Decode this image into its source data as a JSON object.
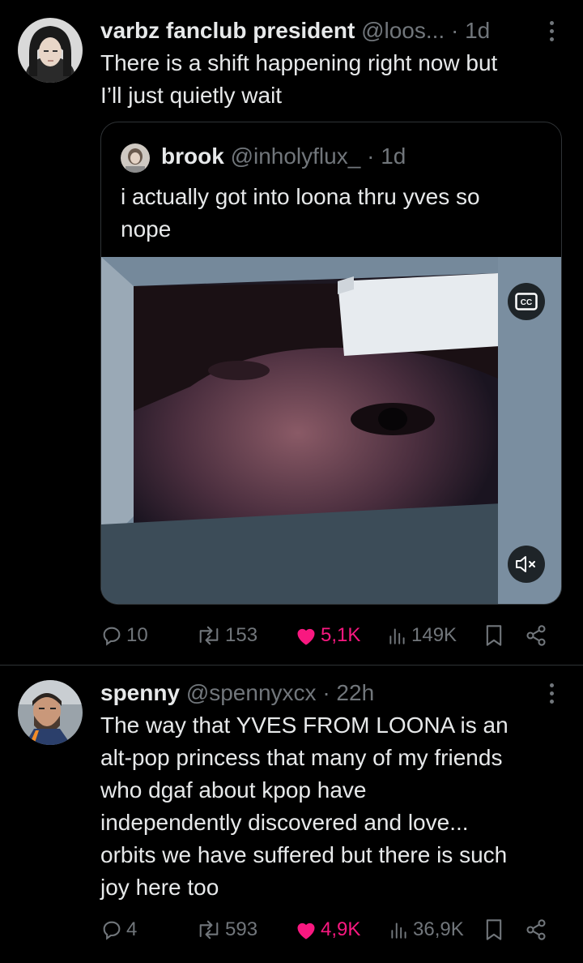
{
  "tweets": [
    {
      "author_name": "varbz fanclub president",
      "handle": "@loos...",
      "separator": "·",
      "time": "1d",
      "text_lines": [
        "There is a shift happening right now but",
        "I’ll just quietly wait"
      ],
      "quote": {
        "author_name": "brook",
        "handle": "@inholyflux_",
        "separator": "·",
        "time": "1d",
        "text_lines": [
          "i actually got into loona thru yves so",
          "nope"
        ],
        "media": {
          "type": "video",
          "captions_button": "CC",
          "mute_icon": "speaker-muted-icon"
        }
      },
      "actions": {
        "replies": "10",
        "reposts": "153",
        "likes": "5,1K",
        "views": "149K",
        "liked": true
      }
    },
    {
      "author_name": "spenny",
      "handle": "@spennyxcx",
      "separator": "·",
      "time": "22h",
      "text_lines": [
        "The way that YVES FROM LOONA is an",
        "alt-pop princess that many of my friends",
        "who dgaf about kpop have",
        "independently discovered and love...",
        "orbits we have suffered but there is such",
        "joy here too"
      ],
      "actions": {
        "replies": "4",
        "reposts": "593",
        "likes": "4,9K",
        "views": "36,9K",
        "liked": true
      }
    }
  ],
  "colors": {
    "background": "#000000",
    "text": "#e7e9ea",
    "muted": "#71767b",
    "like": "#f91880",
    "border": "#2f3336"
  }
}
